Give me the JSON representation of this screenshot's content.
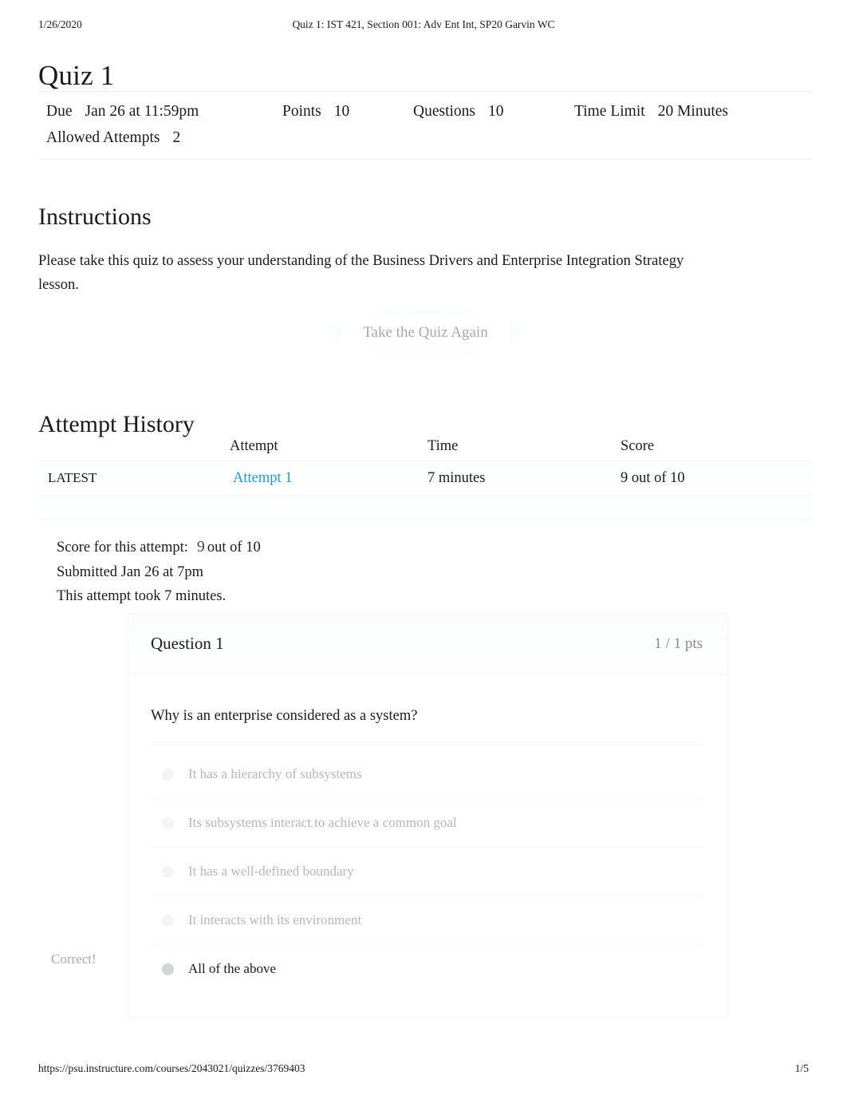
{
  "print_header": {
    "date": "1/26/2020",
    "title": "Quiz 1: IST 421, Section 001: Adv Ent Int, SP20 Garvin WC"
  },
  "quiz": {
    "title": "Quiz 1",
    "meta": {
      "due_label": "Due",
      "due_value": "Jan 26 at 11:59pm",
      "points_label": "Points",
      "points_value": "10",
      "questions_label": "Questions",
      "questions_value": "10",
      "time_limit_label": "Time Limit",
      "time_limit_value": "20 Minutes",
      "allowed_attempts_label": "Allowed Attempts",
      "allowed_attempts_value": "2"
    }
  },
  "instructions": {
    "heading": "Instructions",
    "body": "Please take this quiz to assess your understanding of the Business Drivers and Enterprise Integration Strategy lesson."
  },
  "retake": {
    "label": "Take the Quiz Again"
  },
  "attempt_history": {
    "heading": "Attempt History",
    "columns": {
      "kept": "",
      "attempt": "Attempt",
      "time": "Time",
      "score": "Score"
    },
    "rows": [
      {
        "kept": "LATEST",
        "attempt": "Attempt 1",
        "time": "7 minutes",
        "score": "9 out of 10"
      }
    ]
  },
  "score_summary": {
    "score_label": "Score for this attempt:",
    "score_number": "9",
    "score_outof": "out of 10",
    "submitted": "Submitted Jan 26 at 7pm",
    "duration": "This attempt took 7 minutes."
  },
  "question": {
    "name": "Question 1",
    "points": "1 / 1 pts",
    "text": "Why is an enterprise considered as a system?",
    "correct_flag": "Correct!",
    "answers": [
      {
        "text": "It has a hierarchy of subsystems",
        "selected": false
      },
      {
        "text": "Its subsystems interact to achieve a common goal",
        "selected": false
      },
      {
        "text": "It has a well-defined boundary",
        "selected": false
      },
      {
        "text": "It interacts with its environment",
        "selected": false
      },
      {
        "text": "All of the above",
        "selected": true
      }
    ]
  },
  "footer": {
    "url": "https://psu.instructure.com/courses/2043021/quizzes/3769403",
    "page": "1/5"
  },
  "colors": {
    "link": "#1f9bd6",
    "text": "#1a1a1a",
    "muted": "#a6a7a8",
    "faded_answer": "#b5b6b7"
  }
}
